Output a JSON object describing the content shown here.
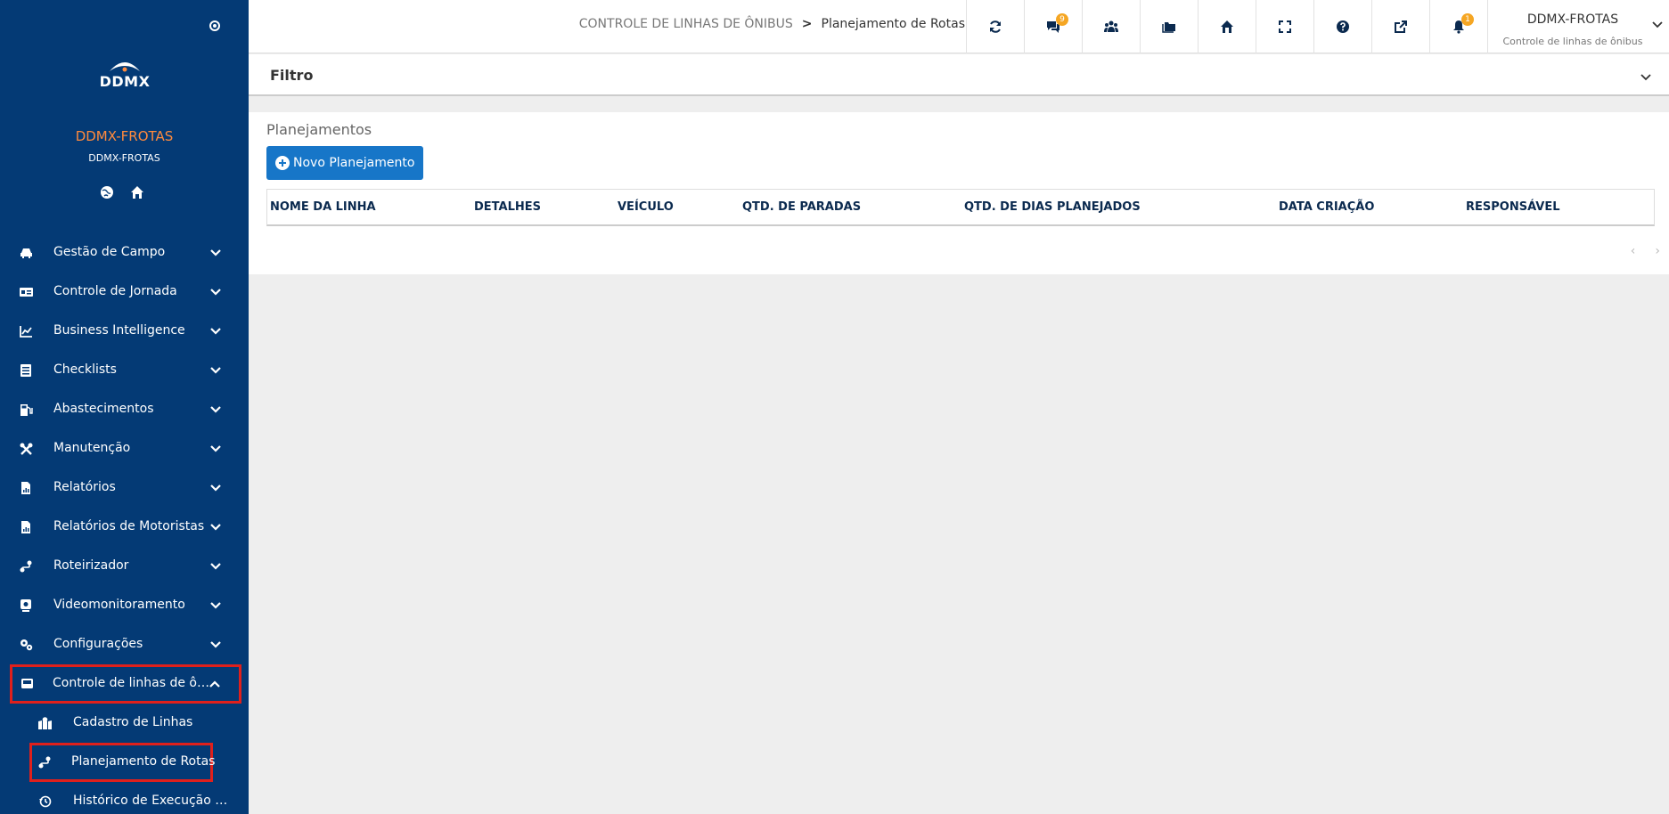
{
  "brand": {
    "logo_text": "DDMX",
    "name": "DDMX-FROTAS",
    "subtitle": "DDMX-FROTAS",
    "accent": "#ff8a3d",
    "sidebar_bg": "#043a75"
  },
  "menu": [
    {
      "label": "Gestão de Campo",
      "icon": "car-icon"
    },
    {
      "label": "Controle de Jornada",
      "icon": "id-card-icon"
    },
    {
      "label": "Business Intelligence",
      "icon": "chart-line-icon"
    },
    {
      "label": "Checklists",
      "icon": "checklist-icon"
    },
    {
      "label": "Abastecimentos",
      "icon": "gas-pump-icon"
    },
    {
      "label": "Manutenção",
      "icon": "tools-icon"
    },
    {
      "label": "Relatórios",
      "icon": "file-chart-icon"
    },
    {
      "label": "Relatórios de Motoristas",
      "icon": "file-chart-icon"
    },
    {
      "label": "Roteirizador",
      "icon": "route-icon"
    },
    {
      "label": "Videomonitoramento",
      "icon": "camera-icon"
    },
    {
      "label": "Configurações",
      "icon": "gears-icon"
    },
    {
      "label": "Controle de linhas de ônibus",
      "icon": "bus-icon",
      "expanded": true
    }
  ],
  "submenu": [
    {
      "label": "Cadastro de Linhas",
      "icon": "map-location-icon"
    },
    {
      "label": "Planejamento de Rotas",
      "icon": "route-icon",
      "active": true
    },
    {
      "label": "Histórico de Execução de Rotas",
      "icon": "history-icon"
    }
  ],
  "breadcrumb": {
    "parent": "CONTROLE DE LINHAS DE ÔNIBUS",
    "separator": ">",
    "current": "Planejamento de Rotas"
  },
  "toolbar": {
    "chat_badge": "9",
    "bell_badge": "1",
    "badge_color": "#f5a623"
  },
  "user": {
    "name": "DDMX-FROTAS",
    "subtitle": "Controle de linhas de ônibus"
  },
  "filter": {
    "title": "Filtro"
  },
  "planning": {
    "title": "Planejamentos",
    "new_button": "Novo Planejamento",
    "columns": [
      "NOME DA LINHA",
      "DETALHES",
      "VEÍCULO",
      "QTD. DE PARADAS",
      "QTD. DE DIAS PLANEJADOS",
      "DATA CRIAÇÃO",
      "RESPONSÁVEL"
    ],
    "pager_prev": "‹",
    "pager_next": "›"
  }
}
